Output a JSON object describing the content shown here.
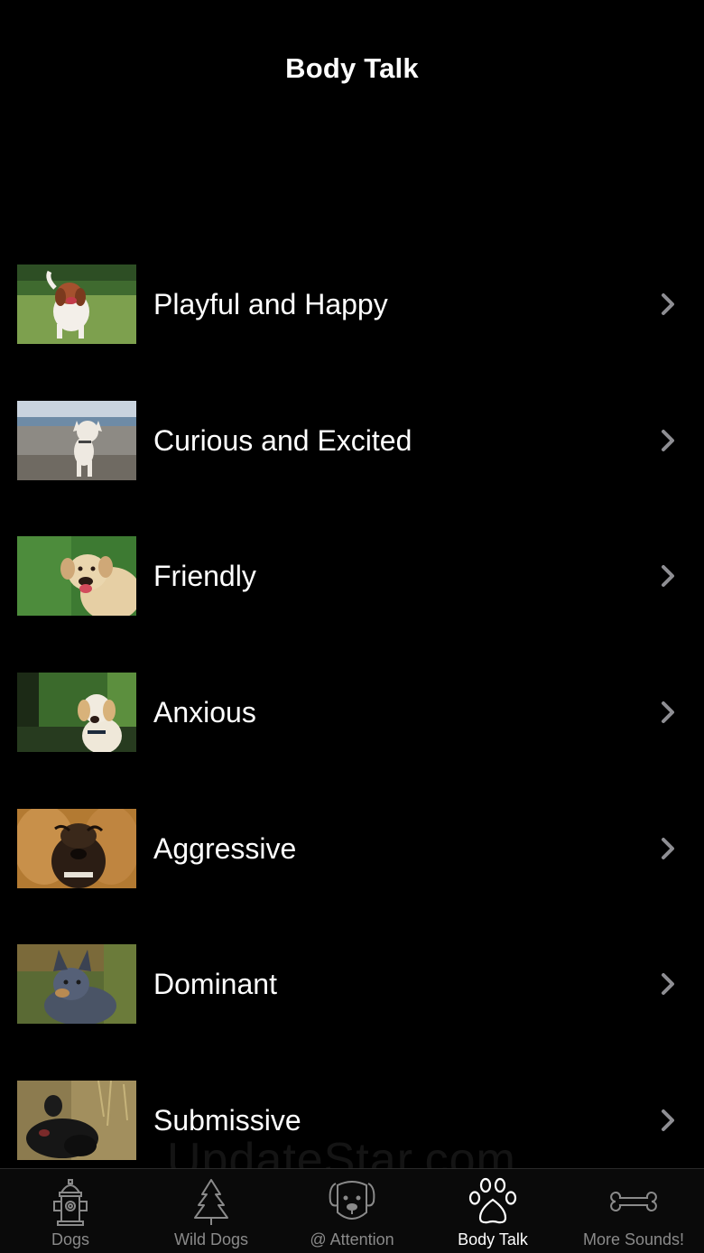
{
  "nav": {
    "title": "Body Talk"
  },
  "items": [
    {
      "label": "Playful and Happy",
      "thumb": "playful-dog-photo"
    },
    {
      "label": "Curious and Excited",
      "thumb": "curious-dog-photo"
    },
    {
      "label": "Friendly",
      "thumb": "friendly-dog-photo"
    },
    {
      "label": "Anxious",
      "thumb": "anxious-dog-photo"
    },
    {
      "label": "Aggressive",
      "thumb": "aggressive-dog-photo"
    },
    {
      "label": "Dominant",
      "thumb": "dominant-dog-photo"
    },
    {
      "label": "Submissive",
      "thumb": "submissive-dog-photo"
    }
  ],
  "watermark": "UpdateStar.com",
  "tabs": [
    {
      "label": "Dogs",
      "icon": "fire-hydrant-icon"
    },
    {
      "label": "Wild Dogs",
      "icon": "pine-tree-icon"
    },
    {
      "label": "@ Attention",
      "icon": "dog-face-icon"
    },
    {
      "label": "Body Talk",
      "icon": "paw-icon",
      "active": true
    },
    {
      "label": "More Sounds!",
      "icon": "bone-icon"
    }
  ],
  "colors": {
    "background": "#000000",
    "tab_inactive": "#8a8a8a",
    "tab_active": "#ffffff",
    "chevron": "#8e8e93"
  }
}
